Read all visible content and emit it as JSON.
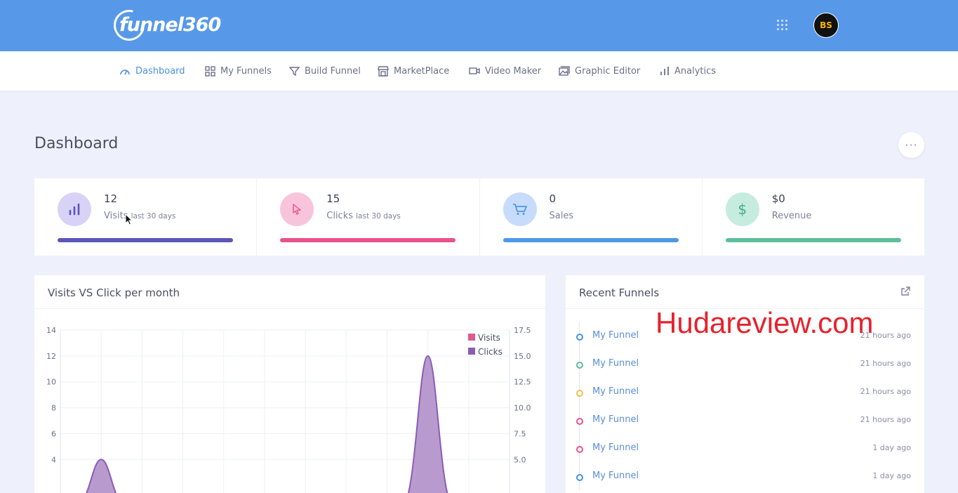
{
  "brand": {
    "logo_text": "funnel360"
  },
  "header": {
    "avatar_initials": "BS"
  },
  "nav": [
    {
      "label": "Dashboard",
      "icon": "gauge-icon"
    },
    {
      "label": "My Funnels",
      "icon": "grid-icon"
    },
    {
      "label": "Build Funnel",
      "icon": "funnel-icon"
    },
    {
      "label": "MarketPlace",
      "icon": "store-icon"
    },
    {
      "label": "Video Maker",
      "icon": "video-icon"
    },
    {
      "label": "Graphic Editor",
      "icon": "image-icon"
    },
    {
      "label": "Analytics",
      "icon": "bar-chart-icon"
    }
  ],
  "page": {
    "title": "Dashboard",
    "more": "···"
  },
  "stats": [
    {
      "value": "12",
      "label": "Visits",
      "sub": "last 30 days",
      "color": "#5b56b8",
      "bg": "#d9d2f7",
      "icon": "bar-chart-icon"
    },
    {
      "value": "15",
      "label": "Clicks",
      "sub": "last 30 days",
      "color": "#e9528b",
      "bg": "#f8c4dc",
      "icon": "cursor-icon"
    },
    {
      "value": "0",
      "label": "Sales",
      "sub": "",
      "color": "#4e98e6",
      "bg": "#c7dcfb",
      "icon": "cart-icon"
    },
    {
      "value": "$0",
      "label": "Revenue",
      "sub": "",
      "color": "#5dbf9a",
      "bg": "#c6ecdf",
      "icon": "dollar-icon"
    }
  ],
  "chart_card": {
    "title": "Visits VS Click per month"
  },
  "chart_data": {
    "type": "area",
    "y_left": {
      "ticks": [
        "14",
        "12",
        "10",
        "8",
        "6",
        "4"
      ],
      "ylim": [
        0,
        14
      ]
    },
    "y_right": {
      "ticks": [
        "17.5",
        "15.0",
        "12.5",
        "10.0",
        "7.5",
        "5.0"
      ],
      "ylim": [
        0,
        17.5
      ]
    },
    "series": [
      {
        "name": "Visits",
        "color": "#e05a8c"
      },
      {
        "name": "Clicks",
        "color": "#8a5cb8",
        "peaks": [
          {
            "x": 2,
            "y": 4
          },
          {
            "x": 10,
            "y": 12
          }
        ]
      }
    ],
    "legend": "top-right"
  },
  "recent": {
    "title": "Recent Funnels",
    "items": [
      {
        "name": "My Funnel",
        "time": "21 hours ago",
        "color": "#4a90e2"
      },
      {
        "name": "My Funnel",
        "time": "21 hours ago",
        "color": "#5dbf9a"
      },
      {
        "name": "My Funnel",
        "time": "21 hours ago",
        "color": "#f2c14e"
      },
      {
        "name": "My Funnel",
        "time": "21 hours ago",
        "color": "#e9528b"
      },
      {
        "name": "My Funnel",
        "time": "1 day ago",
        "color": "#e9528b"
      },
      {
        "name": "My Funnel",
        "time": "1 day ago",
        "color": "#4a90e2"
      }
    ]
  },
  "watermark": "Hudareview.com"
}
